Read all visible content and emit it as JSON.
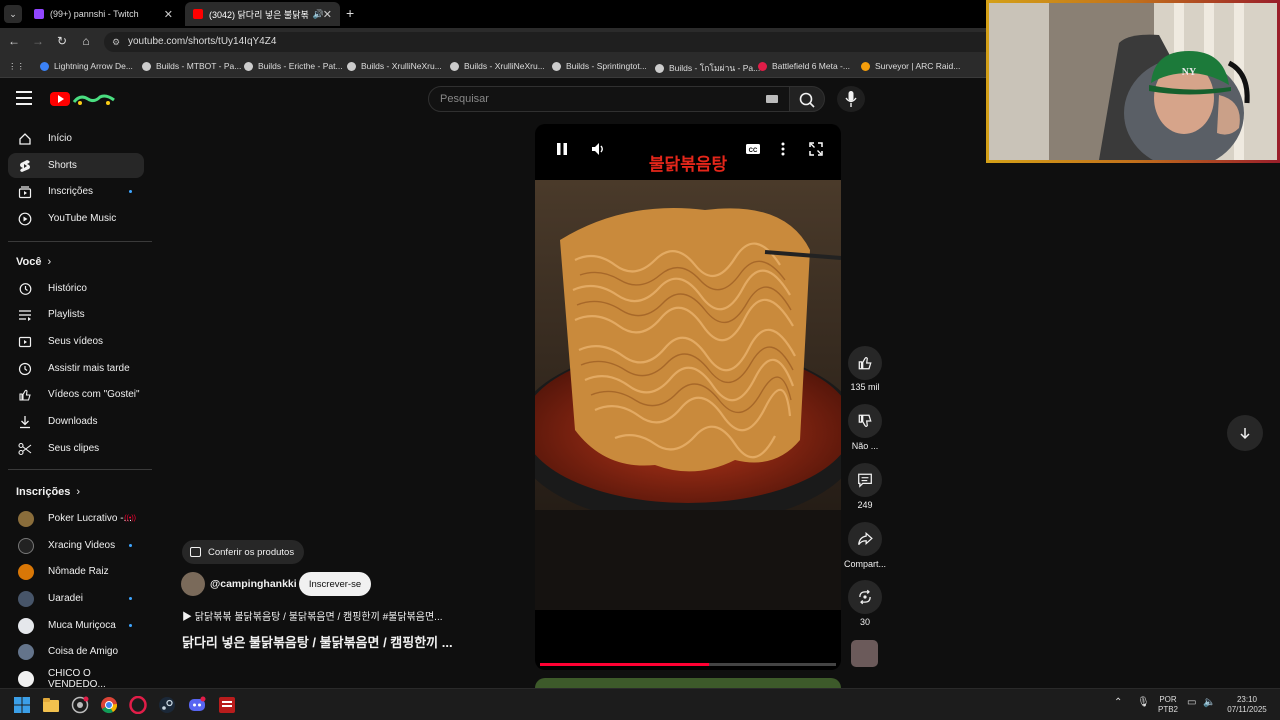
{
  "browser": {
    "tabs": [
      {
        "title": "(99+) pannshi - Twitch",
        "icon_color": "#9146ff"
      },
      {
        "title": "(3042) 닭다리 넣은 불닭볶",
        "icon_color": "#ff0000"
      }
    ],
    "url": "youtube.com/shorts/tUy14IqY4Z4",
    "bookmarks": [
      {
        "label": "Lightning Arrow De...",
        "color": "#3b82f6"
      },
      {
        "label": "Builds - MTBOT - Pa...",
        "color": "#cccccc"
      },
      {
        "label": "Builds - Ericthe - Pat...",
        "color": "#cccccc"
      },
      {
        "label": "Builds - XrulliNeXru...",
        "color": "#cccccc"
      },
      {
        "label": "Builds - XrulliNeXru...",
        "color": "#cccccc"
      },
      {
        "label": "Builds - Sprintingtot...",
        "color": "#cccccc"
      },
      {
        "label": "Builds - โกโมผ่าน - Pa...",
        "color": "#cccccc"
      },
      {
        "label": "Battlefield 6 Meta -...",
        "color": "#e11d48"
      },
      {
        "label": "Surveyor | ARC Raid...",
        "color": "#f59e0b"
      }
    ]
  },
  "header": {
    "search_placeholder": "Pesquisar"
  },
  "sidebar": {
    "main": [
      {
        "label": "Início",
        "icon": "home-icon"
      },
      {
        "label": "Shorts",
        "icon": "shorts-icon",
        "active": true
      },
      {
        "label": "Inscrições",
        "icon": "subscriptions-icon",
        "dot": true
      },
      {
        "label": "YouTube Music",
        "icon": "youtube-music-icon"
      }
    ],
    "you_heading": "Você",
    "you": [
      {
        "label": "Histórico",
        "icon": "history-icon"
      },
      {
        "label": "Playlists",
        "icon": "playlists-icon"
      },
      {
        "label": "Seus vídeos",
        "icon": "your-videos-icon"
      },
      {
        "label": "Assistir mais tarde",
        "icon": "watch-later-icon"
      },
      {
        "label": "Vídeos com \"Gostei\"",
        "icon": "liked-icon"
      },
      {
        "label": "Downloads",
        "icon": "downloads-icon"
      },
      {
        "label": "Seus clipes",
        "icon": "clips-icon"
      }
    ],
    "subs_heading": "Inscrições",
    "subscriptions": [
      {
        "label": "Poker Lucrativo -...",
        "color": "#8a6d3b",
        "live": true
      },
      {
        "label": "Xracing Videos",
        "color": "#222222",
        "dot": true
      },
      {
        "label": "Nômade Raiz",
        "color": "#d97706"
      },
      {
        "label": "Uaradei",
        "color": "#475569",
        "dot": true
      },
      {
        "label": "Muca Muriçoca",
        "color": "#e5e7eb",
        "dot": true
      },
      {
        "label": "Coisa de Amigo",
        "color": "#64748b"
      },
      {
        "label": "CHICO O VENDEDO...",
        "color": "#f1f1f1"
      }
    ]
  },
  "video": {
    "overlay_title": "불닭볶음탕",
    "progress": 0.57,
    "products_label": "Conferir os produtos",
    "channel": "@campinghankki",
    "subscribe_label": "Inscrever-se",
    "description": "▶ 닭닭볶볶 불닭볶음탕 / 불닭볶음면 / 캠핑한끼 #불닭볶음면...",
    "title": "닭다리 넣은 불닭볶음탕 / 불닭볶음면 / 캠핑한끼 ..."
  },
  "actions": {
    "likes": "135 mil",
    "dislike": "Não ...",
    "comments": "249",
    "share": "Compart...",
    "remix": "30"
  },
  "taskbar": {
    "lang_top": "POR",
    "lang_bottom": "PTB2",
    "time": "23:10",
    "date": "07/11/2025"
  }
}
